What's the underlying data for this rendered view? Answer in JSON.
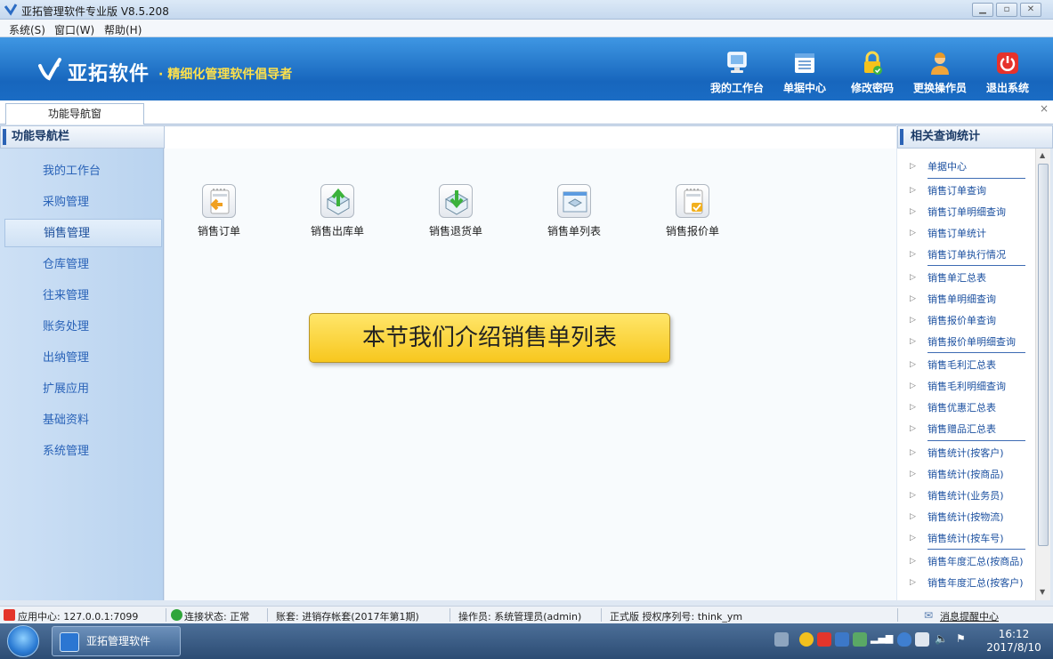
{
  "window": {
    "title": "亚拓管理软件专业版 V8.5.208"
  },
  "menu": {
    "items": [
      "系统(S)",
      "窗口(W)",
      "帮助(H)"
    ]
  },
  "banner": {
    "brand": "亚拓软件",
    "slogan": "· 精细化管理软件倡导者",
    "buttons": [
      {
        "label": "我的工作台",
        "icon": "monitor-icon"
      },
      {
        "label": "单据中心",
        "icon": "document-list-icon"
      },
      {
        "label": "修改密码",
        "icon": "lock-icon"
      },
      {
        "label": "更换操作员",
        "icon": "user-icon"
      },
      {
        "label": "退出系统",
        "icon": "power-icon"
      }
    ]
  },
  "tabs": {
    "active": "功能导航窗",
    "close": "×"
  },
  "left_panel": {
    "title": "功能导航栏",
    "items": [
      "我的工作台",
      "采购管理",
      "销售管理",
      "仓库管理",
      "往来管理",
      "账务处理",
      "出纳管理",
      "扩展应用",
      "基础资料",
      "系统管理"
    ],
    "active": "销售管理"
  },
  "main": {
    "functions": [
      {
        "label": "销售订单",
        "icon": "order-notepad-arrow-icon"
      },
      {
        "label": "销售出库单",
        "icon": "box-up-arrow-icon"
      },
      {
        "label": "销售退货单",
        "icon": "box-down-arrow-icon"
      },
      {
        "label": "销售单列表",
        "icon": "list-window-icon"
      },
      {
        "label": "销售报价单",
        "icon": "notepad-check-icon"
      }
    ],
    "callout": "本节我们介绍销售单列表"
  },
  "right_panel": {
    "title": "相关查询统计",
    "links": [
      "单据中心",
      "销售订单查询",
      "销售订单明细查询",
      "销售订单统计",
      "销售订单执行情况",
      "销售单汇总表",
      "销售单明细查询",
      "销售报价单查询",
      "销售报价单明细查询",
      "销售毛利汇总表",
      "销售毛利明细查询",
      "销售优惠汇总表",
      "销售赠品汇总表",
      "销售统计(按客户)",
      "销售统计(按商品)",
      "销售统计(业务员)",
      "销售统计(按物流)",
      "销售统计(按车号)",
      "销售年度汇总(按商品)",
      "销售年度汇总(按客户)"
    ]
  },
  "status": {
    "app_center": "应用中心: 127.0.0.1:7099",
    "connection": "连接状态: 正常",
    "account": "账套: 进销存帐套(2017年第1期)",
    "operator": "操作员: 系统管理员(admin)",
    "license": "正式版 授权序列号: think_ym",
    "messages": "消息提醒中心"
  },
  "taskbar": {
    "app": "亚拓管理软件",
    "time": "16:12",
    "date": "2017/8/10"
  },
  "colors": {
    "banner": "#1766bd",
    "slogan": "#ffe14a",
    "nav_text": "#2a63b8",
    "callout": "#f7c71e"
  }
}
